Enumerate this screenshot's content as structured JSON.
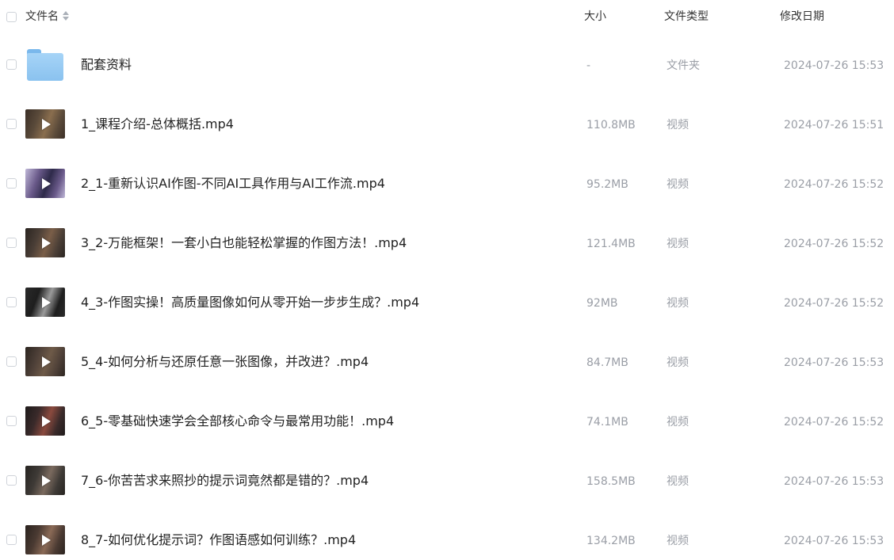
{
  "header": {
    "name_label": "文件名",
    "size_label": "大小",
    "type_label": "文件类型",
    "date_label": "修改日期"
  },
  "rows": [
    {
      "kind": "folder",
      "name": "配套资料",
      "size": "-",
      "type": "文件夹",
      "date": "2024-07-26 15:53"
    },
    {
      "kind": "video",
      "name": "1_课程介绍-总体概括.mp4",
      "size": "110.8MB",
      "type": "视频",
      "date": "2024-07-26 15:51"
    },
    {
      "kind": "video",
      "name": "2_1-重新认识AI作图-不同AI工具作用与AI工作流.mp4",
      "size": "95.2MB",
      "type": "视频",
      "date": "2024-07-26 15:52"
    },
    {
      "kind": "video",
      "name": "3_2-万能框架！一套小白也能轻松掌握的作图方法！.mp4",
      "size": "121.4MB",
      "type": "视频",
      "date": "2024-07-26 15:52"
    },
    {
      "kind": "video",
      "name": "4_3-作图实操！高质量图像如何从零开始一步步生成？.mp4",
      "size": "92MB",
      "type": "视频",
      "date": "2024-07-26 15:52"
    },
    {
      "kind": "video",
      "name": "5_4-如何分析与还原任意一张图像，并改进？.mp4",
      "size": "84.7MB",
      "type": "视频",
      "date": "2024-07-26 15:53"
    },
    {
      "kind": "video",
      "name": "6_5-零基础快速学会全部核心命令与最常用功能！.mp4",
      "size": "74.1MB",
      "type": "视频",
      "date": "2024-07-26 15:52"
    },
    {
      "kind": "video",
      "name": "7_6-你苦苦求来照抄的提示词竟然都是错的？.mp4",
      "size": "158.5MB",
      "type": "视频",
      "date": "2024-07-26 15:53"
    },
    {
      "kind": "video",
      "name": "8_7-如何优化提示词？作图语感如何训练？.mp4",
      "size": "134.2MB",
      "type": "视频",
      "date": "2024-07-26 15:53"
    }
  ],
  "colors": {
    "folder": "#8ac2ef",
    "text_primary": "#222222",
    "text_secondary": "#9a9ea6"
  }
}
